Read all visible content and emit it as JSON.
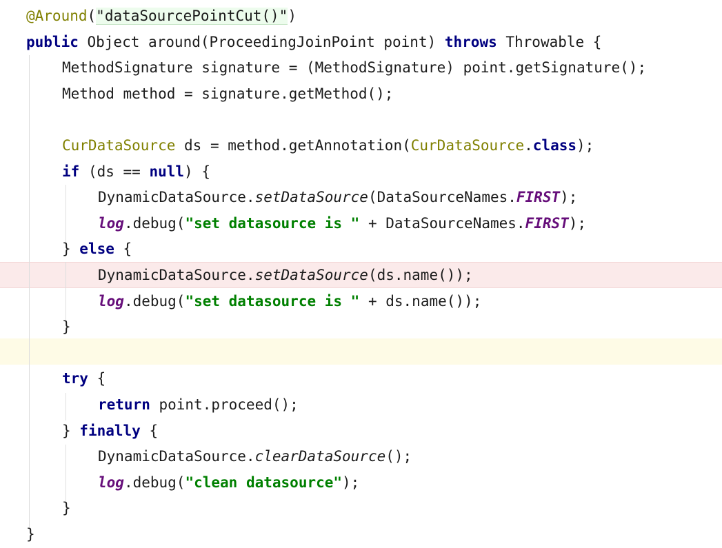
{
  "code": {
    "lines": [
      {
        "indent": 0,
        "tokens": [
          {
            "t": "@Around",
            "c": "ann"
          },
          {
            "t": "(",
            "c": "plain"
          },
          {
            "t": "\"dataSourcePointCut()\"",
            "c": "annstr"
          },
          {
            "t": ")",
            "c": "plain"
          }
        ]
      },
      {
        "indent": 0,
        "tokens": [
          {
            "t": "public",
            "c": "kw"
          },
          {
            "t": " Object around(ProceedingJoinPoint point) ",
            "c": "plain"
          },
          {
            "t": "throws",
            "c": "kw"
          },
          {
            "t": " Throwable {",
            "c": "plain"
          }
        ]
      },
      {
        "indent": 1,
        "tokens": [
          {
            "t": "MethodSignature signature = (MethodSignature) point.getSignature();",
            "c": "plain"
          }
        ]
      },
      {
        "indent": 1,
        "tokens": [
          {
            "t": "Method method = signature.getMethod();",
            "c": "plain"
          }
        ]
      },
      {
        "indent": 1,
        "tokens": []
      },
      {
        "indent": 1,
        "tokens": [
          {
            "t": "CurDataSource",
            "c": "type"
          },
          {
            "t": " ds = method.getAnnotation(",
            "c": "plain"
          },
          {
            "t": "CurDataSource",
            "c": "type"
          },
          {
            "t": ".",
            "c": "plain"
          },
          {
            "t": "class",
            "c": "kw"
          },
          {
            "t": ");",
            "c": "plain"
          }
        ]
      },
      {
        "indent": 1,
        "tokens": [
          {
            "t": "if",
            "c": "kw"
          },
          {
            "t": " (ds == ",
            "c": "plain"
          },
          {
            "t": "null",
            "c": "kw"
          },
          {
            "t": ") {",
            "c": "plain"
          }
        ]
      },
      {
        "indent": 2,
        "tokens": [
          {
            "t": "DynamicDataSource.",
            "c": "plain"
          },
          {
            "t": "setDataSource",
            "c": "static"
          },
          {
            "t": "(DataSourceNames.",
            "c": "plain"
          },
          {
            "t": "FIRST",
            "c": "field"
          },
          {
            "t": ");",
            "c": "plain"
          }
        ]
      },
      {
        "indent": 2,
        "tokens": [
          {
            "t": "log",
            "c": "field"
          },
          {
            "t": ".debug(",
            "c": "plain"
          },
          {
            "t": "\"set datasource is \"",
            "c": "str"
          },
          {
            "t": " + DataSourceNames.",
            "c": "plain"
          },
          {
            "t": "FIRST",
            "c": "field"
          },
          {
            "t": ");",
            "c": "plain"
          }
        ]
      },
      {
        "indent": 1,
        "tokens": [
          {
            "t": "} ",
            "c": "plain"
          },
          {
            "t": "else",
            "c": "kw"
          },
          {
            "t": " {",
            "c": "plain"
          }
        ]
      },
      {
        "indent": 2,
        "tokens": [
          {
            "t": "DynamicDataSource.",
            "c": "plain"
          },
          {
            "t": "setDataSource",
            "c": "static"
          },
          {
            "t": "(ds.name());",
            "c": "plain"
          }
        ]
      },
      {
        "indent": 2,
        "tokens": [
          {
            "t": "log",
            "c": "field"
          },
          {
            "t": ".debug(",
            "c": "plain"
          },
          {
            "t": "\"set datasource is \"",
            "c": "str"
          },
          {
            "t": " + ds.name());",
            "c": "plain"
          }
        ]
      },
      {
        "indent": 1,
        "tokens": [
          {
            "t": "}",
            "c": "plain"
          }
        ]
      },
      {
        "indent": 1,
        "tokens": []
      },
      {
        "indent": 1,
        "tokens": [
          {
            "t": "try",
            "c": "kw"
          },
          {
            "t": " {",
            "c": "plain"
          }
        ]
      },
      {
        "indent": 2,
        "tokens": [
          {
            "t": "return",
            "c": "kw"
          },
          {
            "t": " point.proceed();",
            "c": "plain"
          }
        ]
      },
      {
        "indent": 1,
        "tokens": [
          {
            "t": "} ",
            "c": "plain"
          },
          {
            "t": "finally",
            "c": "kw"
          },
          {
            "t": " {",
            "c": "plain"
          }
        ]
      },
      {
        "indent": 2,
        "tokens": [
          {
            "t": "DynamicDataSource.",
            "c": "plain"
          },
          {
            "t": "clearDataSource",
            "c": "static"
          },
          {
            "t": "();",
            "c": "plain"
          }
        ]
      },
      {
        "indent": 2,
        "tokens": [
          {
            "t": "log",
            "c": "field"
          },
          {
            "t": ".debug(",
            "c": "plain"
          },
          {
            "t": "\"clean datasource\"",
            "c": "str"
          },
          {
            "t": ");",
            "c": "plain"
          }
        ]
      },
      {
        "indent": 1,
        "tokens": [
          {
            "t": "}",
            "c": "plain"
          }
        ]
      },
      {
        "indent": 0,
        "tokens": [
          {
            "t": "}",
            "c": "plain"
          }
        ]
      }
    ],
    "highlighted_error_line": 11,
    "caret_line": 14
  },
  "colors": {
    "keyword": "#000080",
    "string": "#008000",
    "annotation": "#808000",
    "field": "#660e7a",
    "error_line_bg": "#fbeaea",
    "caret_line_bg": "#fefbe6"
  }
}
